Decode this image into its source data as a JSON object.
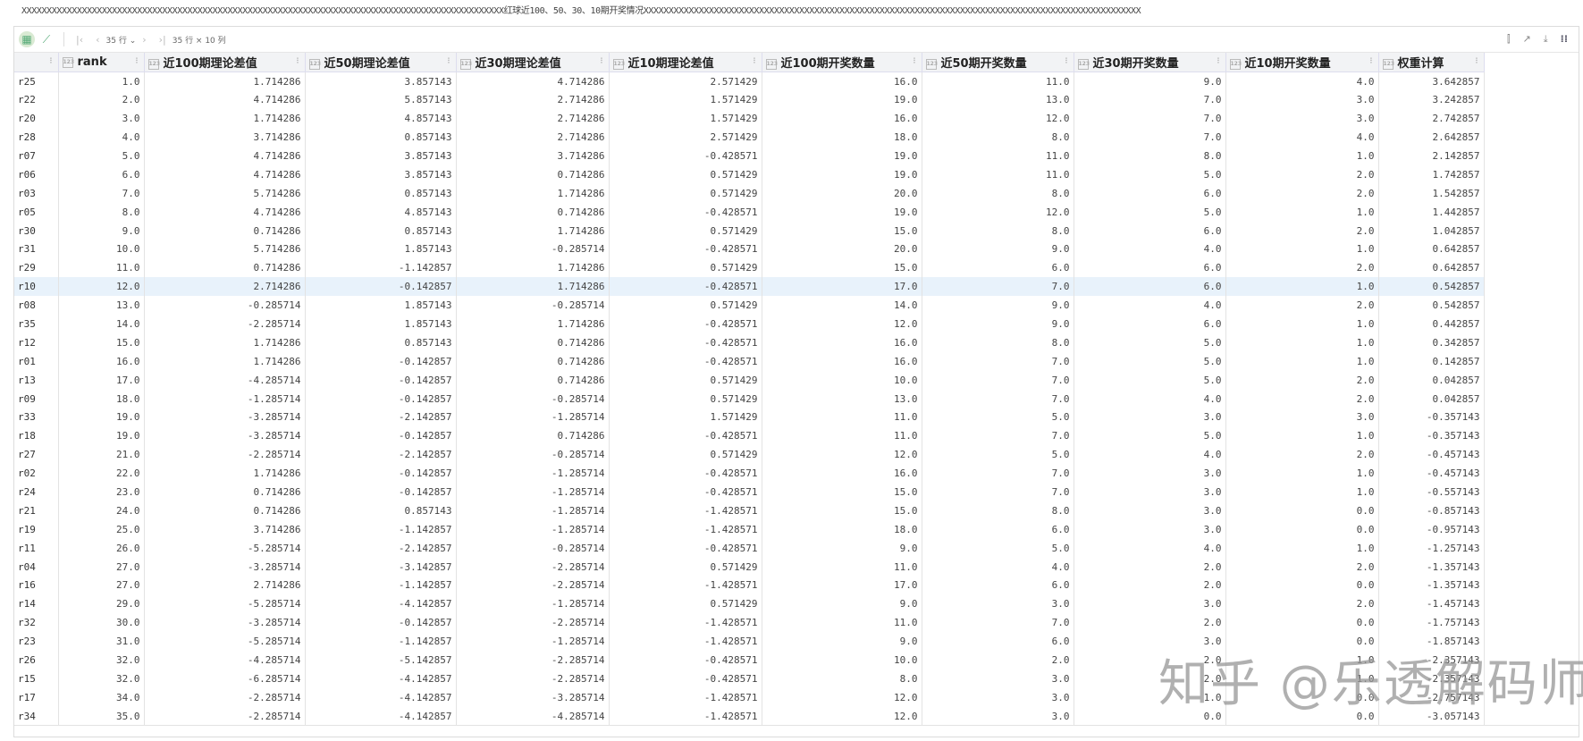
{
  "title": "XXXXXXXXXXXXXXXXXXXXXXXXXXXXXXXXXXXXXXXXXXXXXXXXXXXXXXXXXXXXXXXXXXXXXXXXXXXXXXXXXXXXXXXXXXXXXXXX红球近100、50、30、10期开奖情况XXXXXXXXXXXXXXXXXXXXXXXXXXXXXXXXXXXXXXXXXXXXXXXXXXXXXXXXXXXXXXXXXXXXXXXXXXXXXXXXXXXXXXXXXXXXXXXXXXX",
  "toolbar": {
    "rows_select": "35 行 ⌄",
    "shape": "35 行 × 10 列"
  },
  "columns": [
    "rank",
    "近100期理论差值",
    "近50期理论差值",
    "近30期理论差值",
    "近10期理论差值",
    "近100期开奖数量",
    "近50期开奖数量",
    "近30期开奖数量",
    "近10期开奖数量",
    "权重计算"
  ],
  "highlighted_row": "r10",
  "rows": [
    [
      "r25",
      "1.0",
      "1.714286",
      "3.857143",
      "4.714286",
      "2.571429",
      "16.0",
      "11.0",
      "9.0",
      "4.0",
      "3.642857"
    ],
    [
      "r22",
      "2.0",
      "4.714286",
      "5.857143",
      "2.714286",
      "1.571429",
      "19.0",
      "13.0",
      "7.0",
      "3.0",
      "3.242857"
    ],
    [
      "r20",
      "3.0",
      "1.714286",
      "4.857143",
      "2.714286",
      "1.571429",
      "16.0",
      "12.0",
      "7.0",
      "3.0",
      "2.742857"
    ],
    [
      "r28",
      "4.0",
      "3.714286",
      "0.857143",
      "2.714286",
      "2.571429",
      "18.0",
      "8.0",
      "7.0",
      "4.0",
      "2.642857"
    ],
    [
      "r07",
      "5.0",
      "4.714286",
      "3.857143",
      "3.714286",
      "-0.428571",
      "19.0",
      "11.0",
      "8.0",
      "1.0",
      "2.142857"
    ],
    [
      "r06",
      "6.0",
      "4.714286",
      "3.857143",
      "0.714286",
      "0.571429",
      "19.0",
      "11.0",
      "5.0",
      "2.0",
      "1.742857"
    ],
    [
      "r03",
      "7.0",
      "5.714286",
      "0.857143",
      "1.714286",
      "0.571429",
      "20.0",
      "8.0",
      "6.0",
      "2.0",
      "1.542857"
    ],
    [
      "r05",
      "8.0",
      "4.714286",
      "4.857143",
      "0.714286",
      "-0.428571",
      "19.0",
      "12.0",
      "5.0",
      "1.0",
      "1.442857"
    ],
    [
      "r30",
      "9.0",
      "0.714286",
      "0.857143",
      "1.714286",
      "0.571429",
      "15.0",
      "8.0",
      "6.0",
      "2.0",
      "1.042857"
    ],
    [
      "r31",
      "10.0",
      "5.714286",
      "1.857143",
      "-0.285714",
      "-0.428571",
      "20.0",
      "9.0",
      "4.0",
      "1.0",
      "0.642857"
    ],
    [
      "r29",
      "11.0",
      "0.714286",
      "-1.142857",
      "1.714286",
      "0.571429",
      "15.0",
      "6.0",
      "6.0",
      "2.0",
      "0.642857"
    ],
    [
      "r10",
      "12.0",
      "2.714286",
      "-0.142857",
      "1.714286",
      "-0.428571",
      "17.0",
      "7.0",
      "6.0",
      "1.0",
      "0.542857"
    ],
    [
      "r08",
      "13.0",
      "-0.285714",
      "1.857143",
      "-0.285714",
      "0.571429",
      "14.0",
      "9.0",
      "4.0",
      "2.0",
      "0.542857"
    ],
    [
      "r35",
      "14.0",
      "-2.285714",
      "1.857143",
      "1.714286",
      "-0.428571",
      "12.0",
      "9.0",
      "6.0",
      "1.0",
      "0.442857"
    ],
    [
      "r12",
      "15.0",
      "1.714286",
      "0.857143",
      "0.714286",
      "-0.428571",
      "16.0",
      "8.0",
      "5.0",
      "1.0",
      "0.342857"
    ],
    [
      "r01",
      "16.0",
      "1.714286",
      "-0.142857",
      "0.714286",
      "-0.428571",
      "16.0",
      "7.0",
      "5.0",
      "1.0",
      "0.142857"
    ],
    [
      "r13",
      "17.0",
      "-4.285714",
      "-0.142857",
      "0.714286",
      "0.571429",
      "10.0",
      "7.0",
      "5.0",
      "2.0",
      "0.042857"
    ],
    [
      "r09",
      "18.0",
      "-1.285714",
      "-0.142857",
      "-0.285714",
      "0.571429",
      "13.0",
      "7.0",
      "4.0",
      "2.0",
      "0.042857"
    ],
    [
      "r33",
      "19.0",
      "-3.285714",
      "-2.142857",
      "-1.285714",
      "1.571429",
      "11.0",
      "5.0",
      "3.0",
      "3.0",
      "-0.357143"
    ],
    [
      "r18",
      "19.0",
      "-3.285714",
      "-0.142857",
      "0.714286",
      "-0.428571",
      "11.0",
      "7.0",
      "5.0",
      "1.0",
      "-0.357143"
    ],
    [
      "r27",
      "21.0",
      "-2.285714",
      "-2.142857",
      "-0.285714",
      "0.571429",
      "12.0",
      "5.0",
      "4.0",
      "2.0",
      "-0.457143"
    ],
    [
      "r02",
      "22.0",
      "1.714286",
      "-0.142857",
      "-1.285714",
      "-0.428571",
      "16.0",
      "7.0",
      "3.0",
      "1.0",
      "-0.457143"
    ],
    [
      "r24",
      "23.0",
      "0.714286",
      "-0.142857",
      "-1.285714",
      "-0.428571",
      "15.0",
      "7.0",
      "3.0",
      "1.0",
      "-0.557143"
    ],
    [
      "r21",
      "24.0",
      "0.714286",
      "0.857143",
      "-1.285714",
      "-1.428571",
      "15.0",
      "8.0",
      "3.0",
      "0.0",
      "-0.857143"
    ],
    [
      "r19",
      "25.0",
      "3.714286",
      "-1.142857",
      "-1.285714",
      "-1.428571",
      "18.0",
      "6.0",
      "3.0",
      "0.0",
      "-0.957143"
    ],
    [
      "r11",
      "26.0",
      "-5.285714",
      "-2.142857",
      "-0.285714",
      "-0.428571",
      "9.0",
      "5.0",
      "4.0",
      "1.0",
      "-1.257143"
    ],
    [
      "r04",
      "27.0",
      "-3.285714",
      "-3.142857",
      "-2.285714",
      "0.571429",
      "11.0",
      "4.0",
      "2.0",
      "2.0",
      "-1.357143"
    ],
    [
      "r16",
      "27.0",
      "2.714286",
      "-1.142857",
      "-2.285714",
      "-1.428571",
      "17.0",
      "6.0",
      "2.0",
      "0.0",
      "-1.357143"
    ],
    [
      "r14",
      "29.0",
      "-5.285714",
      "-4.142857",
      "-1.285714",
      "0.571429",
      "9.0",
      "3.0",
      "3.0",
      "2.0",
      "-1.457143"
    ],
    [
      "r32",
      "30.0",
      "-3.285714",
      "-0.142857",
      "-2.285714",
      "-1.428571",
      "11.0",
      "7.0",
      "2.0",
      "0.0",
      "-1.757143"
    ],
    [
      "r23",
      "31.0",
      "-5.285714",
      "-1.142857",
      "-1.285714",
      "-1.428571",
      "9.0",
      "6.0",
      "3.0",
      "0.0",
      "-1.857143"
    ],
    [
      "r26",
      "32.0",
      "-4.285714",
      "-5.142857",
      "-2.285714",
      "-0.428571",
      "10.0",
      "2.0",
      "2.0",
      "1.0",
      "-2.357143"
    ],
    [
      "r15",
      "32.0",
      "-6.285714",
      "-4.142857",
      "-2.285714",
      "-0.428571",
      "8.0",
      "3.0",
      "2.0",
      "1.0",
      "-2.357143"
    ],
    [
      "r17",
      "34.0",
      "-2.285714",
      "-4.142857",
      "-3.285714",
      "-1.428571",
      "12.0",
      "3.0",
      "1.0",
      "0.0",
      "-2.757143"
    ],
    [
      "r34",
      "35.0",
      "-2.285714",
      "-4.142857",
      "-4.285714",
      "-1.428571",
      "12.0",
      "3.0",
      "0.0",
      "0.0",
      "-3.057143"
    ]
  ],
  "watermark": "知乎 @乐透解码师"
}
